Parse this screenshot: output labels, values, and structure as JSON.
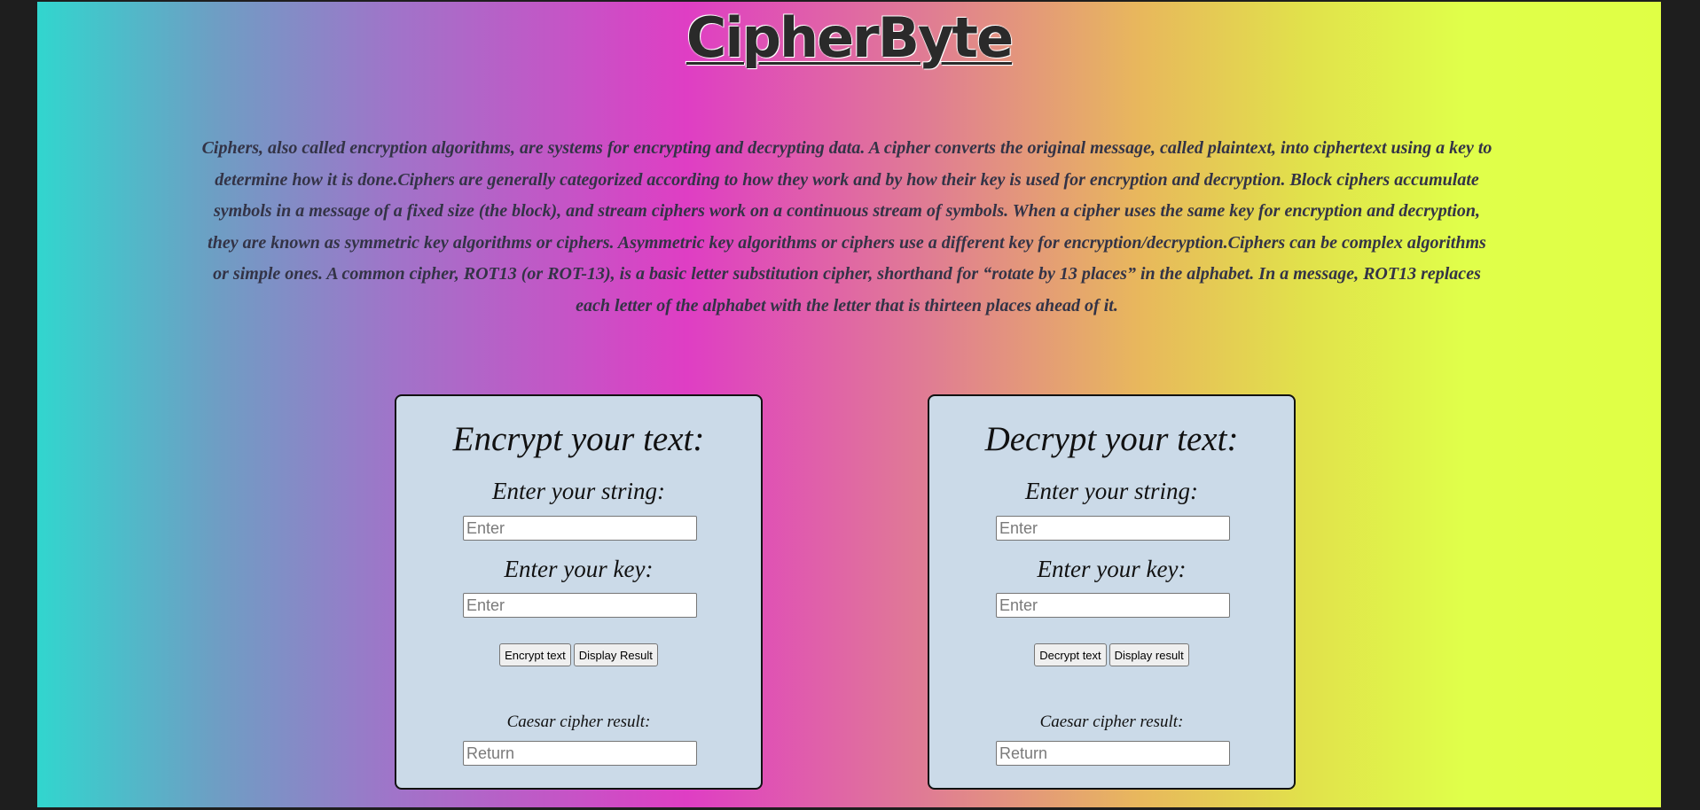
{
  "header": {
    "logo": "CipherByte"
  },
  "intro": {
    "text": "Ciphers, also called encryption algorithms, are systems for encrypting and decrypting data. A cipher converts the original message, called plaintext, into ciphertext using a key to determine how it is done.Ciphers are generally categorized according to how they work and by how their key is used for encryption and decryption. Block ciphers accumulate symbols in a message of a fixed size (the block), and stream ciphers work on a continuous stream of symbols. When a cipher uses the same key for encryption and decryption, they are known as symmetric key algorithms or ciphers. Asymmetric key algorithms or ciphers use a different key for encryption/decryption.Ciphers can be complex algorithms or simple ones. A common cipher, ROT13 (or ROT-13), is a basic letter substitution cipher, shorthand for “rotate by 13 places” in the alphabet. In a message, ROT13 replaces each letter of the alphabet with the letter that is thirteen places ahead of it."
  },
  "encrypt": {
    "title": "Encrypt your text:",
    "string_label": "Enter your string:",
    "string_placeholder": "Enter",
    "key_label": "Enter your key:",
    "key_placeholder": "Enter",
    "action_button": "Encrypt text",
    "display_button": "Display Result",
    "result_label": "Caesar cipher result:",
    "result_placeholder": "Return"
  },
  "decrypt": {
    "title": "Decrypt your text:",
    "string_label": "Enter your string:",
    "string_placeholder": "Enter",
    "key_label": "Enter your key:",
    "key_placeholder": "Enter",
    "action_button": "Decrypt text",
    "display_button": "Display result",
    "result_label": "Caesar cipher result:",
    "result_placeholder": "Return"
  },
  "colors": {
    "gradient_start": "#31d6ce",
    "gradient_mid": "#df3ec4",
    "gradient_end": "#e0ff45",
    "card_background": "#cbdae8"
  }
}
